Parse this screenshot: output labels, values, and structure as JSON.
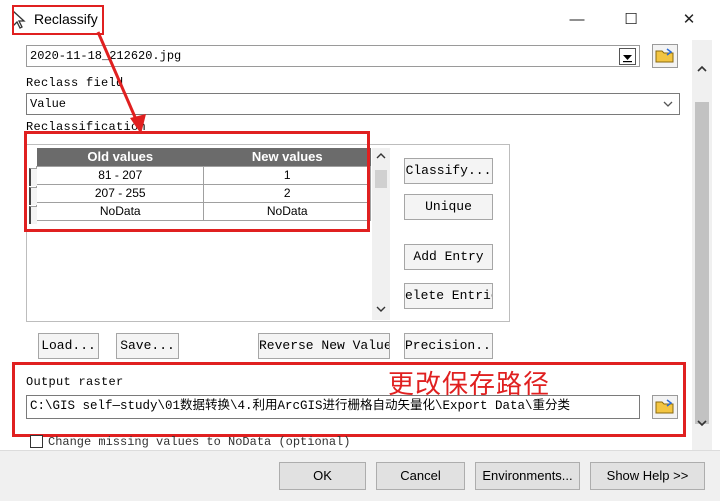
{
  "window": {
    "title": "Reclassify",
    "minimize_glyph": "—",
    "maximize_glyph": "☐",
    "close_glyph": "✕"
  },
  "input_raster": {
    "value": "2020-11-18_212620.jpg"
  },
  "reclass_field": {
    "label": "Reclass field",
    "value": "Value"
  },
  "reclassification": {
    "label": "Reclassification",
    "columns": [
      "Old values",
      "New values"
    ],
    "rows": [
      {
        "old": "81 - 207",
        "new": "1"
      },
      {
        "old": "207 - 255",
        "new": "2"
      },
      {
        "old": "NoData",
        "new": "NoData"
      }
    ],
    "side_buttons": [
      "Classify...",
      "Unique",
      "Add Entry",
      "elete Entrie"
    ],
    "bottom_buttons": [
      "Load...",
      "Save...",
      "Reverse New Values",
      "Precision..."
    ]
  },
  "output_raster": {
    "label": "Output raster",
    "value": "C:\\GIS  self—study\\01数据转换\\4.利用ArcGIS进行栅格自动矢量化\\Export Data\\重分类"
  },
  "annotation": {
    "text": "更改保存路径",
    "color": "#e02020"
  },
  "change_missing": {
    "label": "Change missing values to NoData (optional)",
    "checked": false
  },
  "footer": {
    "ok": "OK",
    "cancel": "Cancel",
    "environments": "Environments...",
    "show_help": "Show Help >>"
  },
  "colors": {
    "header_bg": "#6b6b6b",
    "annotation_red": "#e02020",
    "footer_bg": "#f0f0f0"
  }
}
